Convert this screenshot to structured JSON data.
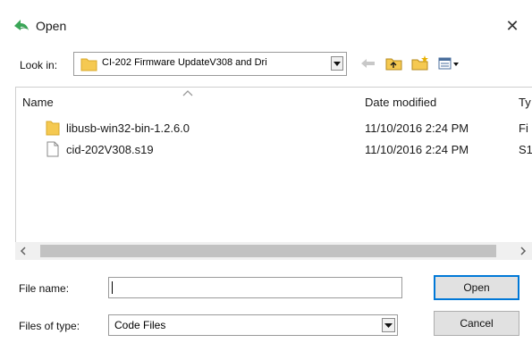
{
  "window": {
    "title": "Open",
    "close_glyph": "✕"
  },
  "toolbar": {
    "look_in_label": "Look in:",
    "look_in_value": "CI-202 Firmware UpdateV308 and Dri",
    "icons": [
      "back-arrow-icon",
      "up-folder-icon",
      "new-folder-icon",
      "view-menu-icon"
    ]
  },
  "file_list": {
    "columns": {
      "name": "Name",
      "date_modified": "Date modified",
      "type": "Ty"
    },
    "rows": [
      {
        "name": "libusb-win32-bin-1.2.6.0",
        "date": "11/10/2016 2:24 PM",
        "type": "Fi",
        "icon": "folder-icon"
      },
      {
        "name": "cid-202V308.s19",
        "date": "11/10/2016 2:24 PM",
        "type": "S1",
        "icon": "file-icon"
      }
    ]
  },
  "form": {
    "file_name_label": "File name:",
    "file_name_value": "",
    "files_of_type_label": "Files of type:",
    "files_of_type_value": "Code Files",
    "open_label": "Open",
    "cancel_label": "Cancel"
  },
  "colors": {
    "folder": "#f5c951",
    "accent": "#0078d7",
    "app_icon": "#3aa657"
  }
}
